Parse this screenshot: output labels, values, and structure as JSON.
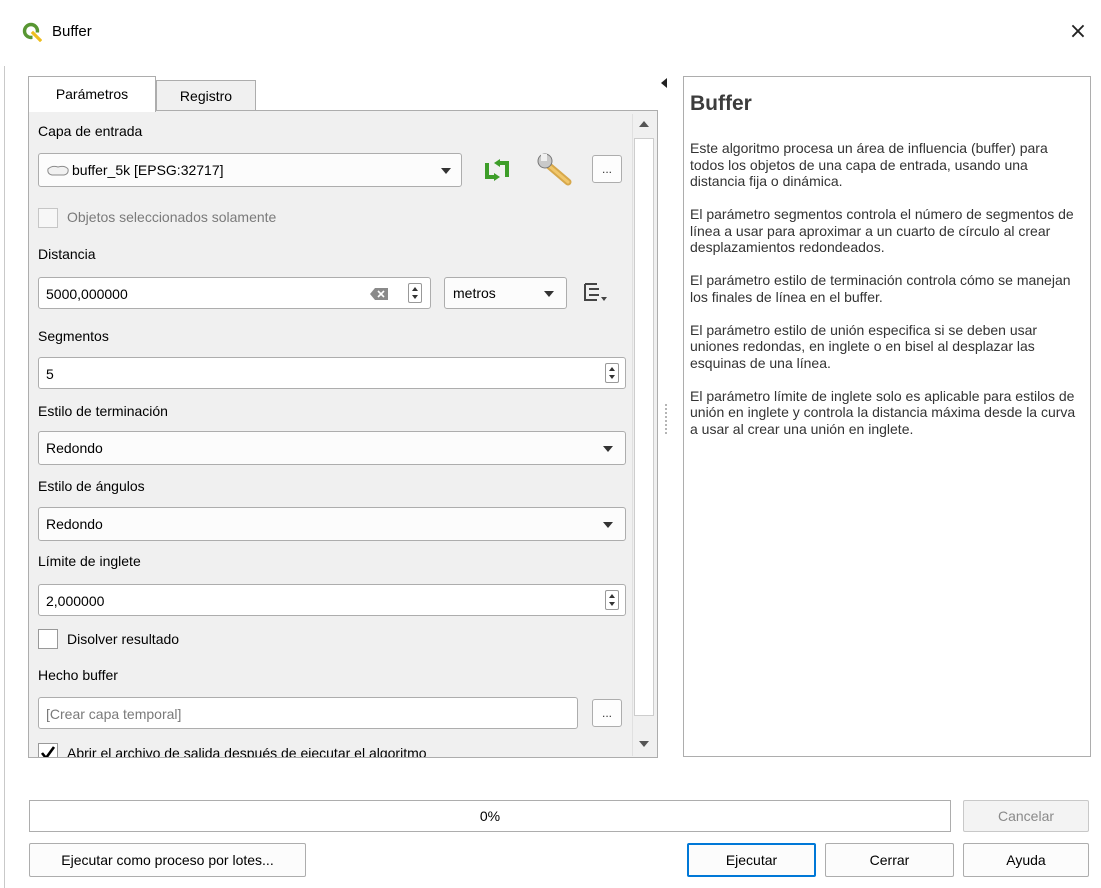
{
  "window": {
    "title": "Buffer",
    "close_glyph": "×",
    "icon": "qgis-logo-icon"
  },
  "tabs": [
    {
      "label": "Parámetros",
      "active": true
    },
    {
      "label": "Registro",
      "active": false
    }
  ],
  "params": {
    "input_layer": {
      "label": "Capa de entrada",
      "value": "buffer_5k [EPSG:32717]",
      "layer_icon": "polygon-layer-icon",
      "iterate_icon": "iterate-icon",
      "settings_icon": "wrench-icon",
      "browse_label": "..."
    },
    "selected_only": {
      "label": "Objetos seleccionados solamente",
      "checked": false,
      "enabled": false
    },
    "distance": {
      "label": "Distancia",
      "value": "5000,000000",
      "unit": "metros",
      "data_defined_icon": "data-defined-icon"
    },
    "segments": {
      "label": "Segmentos",
      "value": "5"
    },
    "end_cap": {
      "label": "Estilo de terminación",
      "value": "Redondo"
    },
    "join_style": {
      "label": "Estilo de ángulos",
      "value": "Redondo"
    },
    "miter_limit": {
      "label": "Límite de inglete",
      "value": "2,000000"
    },
    "dissolve": {
      "label": "Disolver resultado",
      "checked": false
    },
    "output": {
      "label": "Hecho buffer",
      "placeholder": "[Crear capa temporal]",
      "browse_label": "..."
    },
    "open_output": {
      "label": "Abrir el archivo de salida después de ejecutar el algoritmo",
      "checked": true
    }
  },
  "help": {
    "title": "Buffer",
    "paragraphs": [
      "Este algoritmo procesa un área de influencia (buffer) para todos los objetos de una capa de entrada, usando una distancia fija o dinámica.",
      "El parámetro segmentos controla el número de segmentos de línea a usar para aproximar a un cuarto de círculo al crear desplazamientos redondeados.",
      "El parámetro estilo de terminación controla cómo se manejan los finales de línea en el buffer.",
      "El parámetro estilo de unión especifica si se deben usar uniones redondas, en inglete o en bisel al desplazar las esquinas de una línea.",
      "El parámetro límite de inglete solo es aplicable para estilos de unión en inglete y controla la distancia máxima desde la curva a usar al crear una unión en inglete."
    ]
  },
  "progress": {
    "text": "0%",
    "percent": 0
  },
  "buttons": {
    "cancel": "Cancelar",
    "batch": "Ejecutar como proceso por lotes...",
    "run": "Ejecutar",
    "close": "Cerrar",
    "help": "Ayuda"
  },
  "colors": {
    "accent": "#0078d7",
    "qgis_green": "#589632",
    "qgis_yellow": "#ee7913"
  }
}
